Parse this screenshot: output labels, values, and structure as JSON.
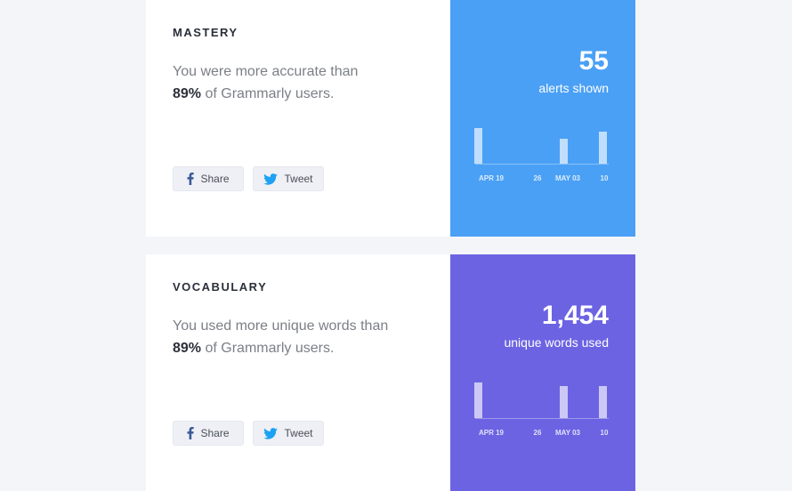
{
  "mastery": {
    "heading": "MASTERY",
    "desc_prefix": "You were more accurate than",
    "percent": "89%",
    "desc_suffix": "of Grammarly users.",
    "share_label": "Share",
    "tweet_label": "Tweet",
    "stat_value": "55",
    "stat_label": "alerts shown",
    "panel_color": "#4aa0f5",
    "chart_data": {
      "type": "bar",
      "tick_labels": [
        "APR 19",
        "26",
        "MAY 03",
        "10"
      ],
      "values": [
        40,
        0,
        28,
        36
      ]
    }
  },
  "vocabulary": {
    "heading": "VOCABULARY",
    "desc_prefix": "You used more unique words than",
    "percent": "89%",
    "desc_suffix": "of Grammarly users.",
    "share_label": "Share",
    "tweet_label": "Tweet",
    "stat_value": "1,454",
    "stat_label": "unique words used",
    "panel_color": "#6c63e3",
    "chart_data": {
      "type": "bar",
      "tick_labels": [
        "APR 19",
        "26",
        "MAY 03",
        "10"
      ],
      "values": [
        40,
        0,
        36,
        36
      ]
    }
  },
  "icons": {
    "share": "facebook-icon",
    "tweet": "twitter-icon"
  }
}
